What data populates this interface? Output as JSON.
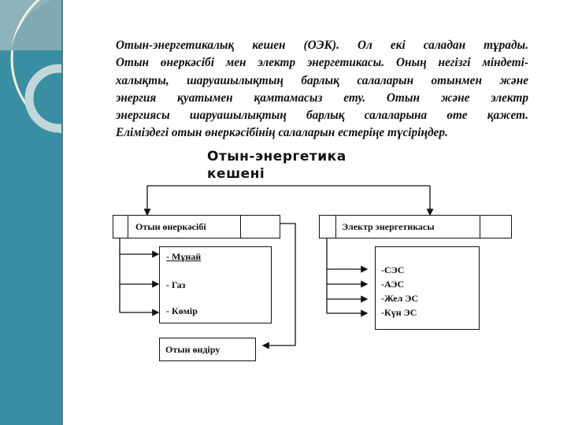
{
  "slide": {
    "colors": {
      "side_panel": "#3a8ea3",
      "text": "#111111"
    },
    "paragraph_lines": [
      "Отын-энергетикалық кешен (ОЭК). Ол екі саладан тұрады.",
      "Отын өнеркәсібі мен электр энергетикасы. Оның негізгі міндеті-",
      "халықты, шаруашылықтың барлық салаларын отынмен және",
      "энергия қуатымен қамтамасыз ету. Отын және электр",
      "энергиясы шаруашылықтың барлық салаларына өте қажет.",
      "Еліміздегі отын өнеркәсібінің салаларын естеріңе түсіріңдер."
    ]
  },
  "diagram": {
    "title_line1": "Отын-энергетика",
    "title_line2": "кешені",
    "left_branch": {
      "label": "Отын өнеркәсібі",
      "items": [
        "- Мұнай",
        "- Газ",
        "- Көмір"
      ],
      "output": "Отын өндіру"
    },
    "right_branch": {
      "label": "Электр энергетикасы",
      "items": [
        "-СЭС",
        "-АЭС",
        "-Жел ЭС",
        "-Күн ЭС"
      ]
    }
  }
}
